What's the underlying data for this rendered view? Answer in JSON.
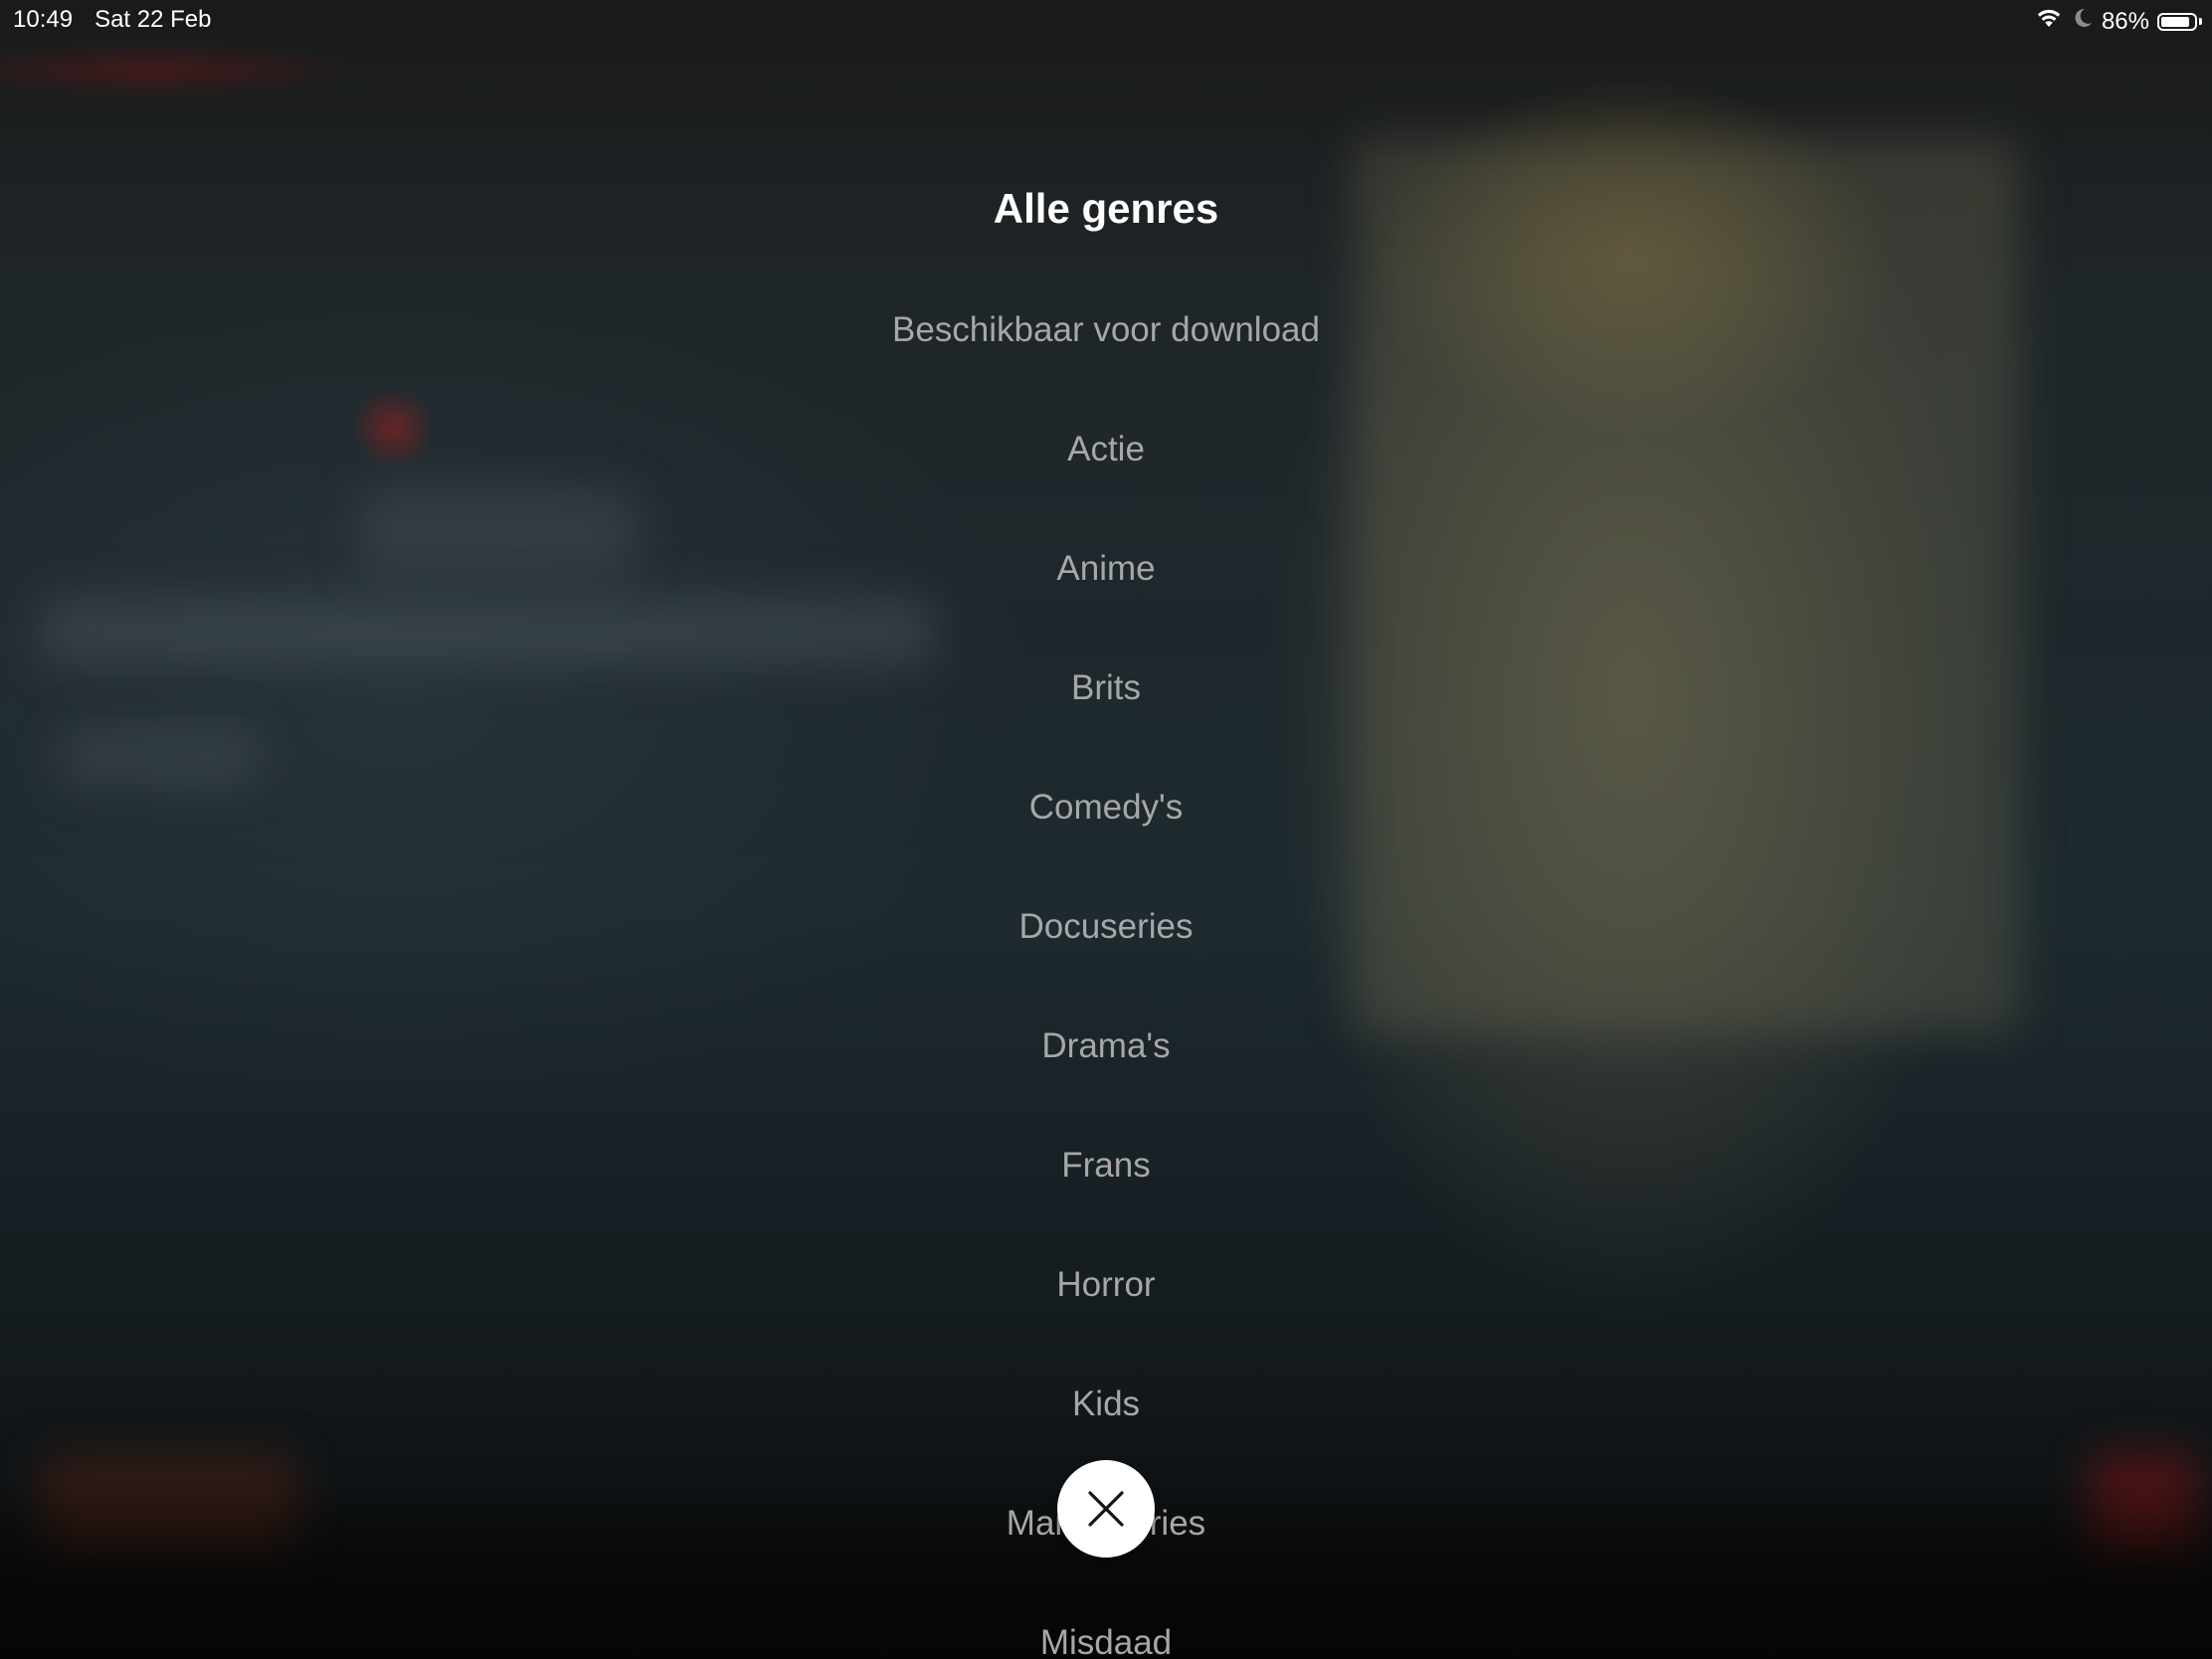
{
  "status_bar": {
    "time": "10:49",
    "date": "Sat 22 Feb",
    "battery_text": "86%",
    "battery_level": 0.86,
    "icons": [
      "wifi-icon",
      "moon-icon",
      "battery-icon"
    ]
  },
  "genre_menu": {
    "title": "Alle genres",
    "items": [
      "Beschikbaar voor download",
      "Actie",
      "Anime",
      "Brits",
      "Comedy's",
      "Docuseries",
      "Drama's",
      "Frans",
      "Horror",
      "Kids",
      "Mangaseries",
      "Misdaad"
    ],
    "close_icon": "close-icon"
  },
  "colors": {
    "title": "#ffffff",
    "item_text": "#a7a7a7",
    "close_button_bg": "#ffffff",
    "close_icon": "#141414"
  }
}
